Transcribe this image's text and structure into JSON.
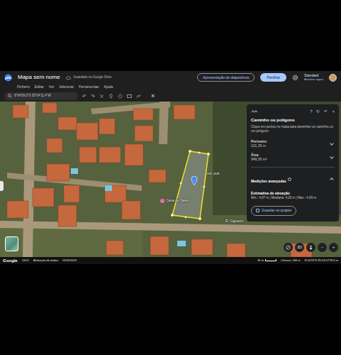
{
  "app": {
    "title": "Mapa sem nome",
    "save_status": "Guardado no Google Drive",
    "slideshow_button": "Apresentação de diapositivos",
    "share_button": "Partilhar",
    "plan": "Standard",
    "upgrade": "Atualizar agora"
  },
  "menu": [
    "Ficheiro",
    "Editar",
    "Ver",
    "Adicionar",
    "Ferramentas",
    "Ajuda"
  ],
  "search": {
    "value": "8°04'59,0\"S 35°04'11,4\"W"
  },
  "toolbar": [
    "↶",
    "↷"
  ],
  "map_close": "×",
  "measure_panel": {
    "header_icons": [
      "?",
      "↻",
      "↶",
      "×"
    ],
    "title": "Caminho ou polígono",
    "instructions": "Clique em pontos no mapa para desenhar um caminho ou um polígono",
    "metrics": [
      {
        "label": "Perímetro",
        "value": "131,35 m"
      },
      {
        "label": "Área",
        "value": "948,36 m²"
      }
    ],
    "advanced": {
      "title": "Medições avançadas",
      "expanded": true,
      "label": "Estimativa de elevação",
      "value": "Mín.: 4,07 m | Mediana: 4,29 m | Máx.: 4,99 m"
    },
    "save_button": "Guardar no projeto"
  },
  "map_labels": [
    {
      "text": "Casa de Sales"
    },
    {
      "text": "R. Cajueiro"
    },
    {
      "text": "esc pub"
    }
  ],
  "map_controls": [
    "3D",
    "−",
    "+"
  ],
  "status_bar": {
    "brand": "Google",
    "zoom": "100%",
    "attribution": "Atribuição de dados",
    "date": "05/05/2025",
    "scale": "30 m",
    "camera": "Câmara: 246 m",
    "coords": "8°04'59\"S 35°04'12\"W 4 m"
  }
}
